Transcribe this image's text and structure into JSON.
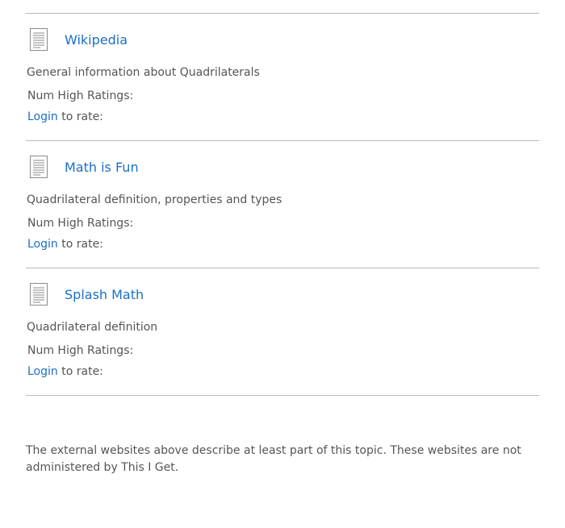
{
  "resources": [
    {
      "title": "Wikipedia",
      "description": "General information about Quadrilaterals",
      "ratings_label": "Num High Ratings:",
      "login_label": "Login",
      "rate_suffix": "to rate:"
    },
    {
      "title": "Math is Fun",
      "description": "Quadrilateral definition, properties and types",
      "ratings_label": "Num High Ratings:",
      "login_label": "Login",
      "rate_suffix": "to rate:"
    },
    {
      "title": "Splash Math",
      "description": "Quadrilateral definition",
      "ratings_label": "Num High Ratings:",
      "login_label": "Login",
      "rate_suffix": "to rate:"
    }
  ],
  "disclaimer": "The external websites above describe at least part of this topic. These websites are not administered by This I Get.",
  "colors": {
    "link": "#1a6fc6",
    "text": "#555555",
    "divider": "#b9b9b9"
  },
  "icons": {
    "resource": "document-icon"
  }
}
